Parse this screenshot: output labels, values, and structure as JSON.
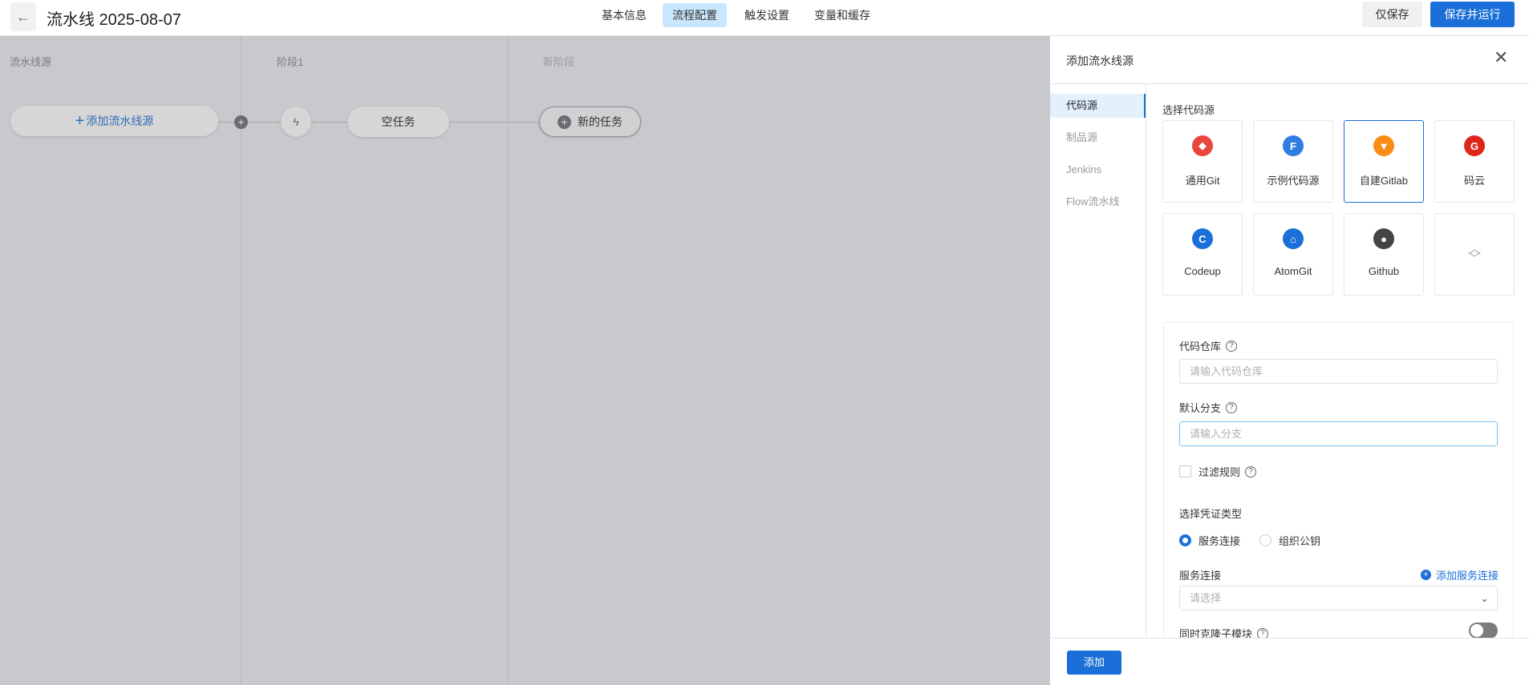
{
  "header": {
    "back_icon": "arrow-left-icon",
    "title": "流水线 2025-08-07",
    "tabs": [
      "基本信息",
      "流程配置",
      "触发设置",
      "变量和缓存"
    ],
    "active_tab": "流程配置",
    "save_only": "仅保存",
    "save_run": "保存并运行",
    "accent": "#1b6fd8"
  },
  "canvas": {
    "columns": [
      "流水线源",
      "阶段1",
      "新阶段"
    ],
    "add_source": "添加流水线源",
    "empty_task": "空任务",
    "new_task": "新的任务"
  },
  "panel": {
    "title": "添加流水线源",
    "side": [
      "代码源",
      "制品源",
      "Jenkins",
      "Flow流水线"
    ],
    "select_label": "选择代码源",
    "sources": [
      {
        "label": "通用Git",
        "icon": "git-icon",
        "color": "#e8463c"
      },
      {
        "label": "示例代码源",
        "icon": "flow-f-icon",
        "color": "#2f7de1"
      },
      {
        "label": "自建Gitlab",
        "icon": "gitlab-icon",
        "color": "#fa8c16"
      },
      {
        "label": "码云",
        "icon": "gitee-icon",
        "color": "#e1251b"
      },
      {
        "label": "Codeup",
        "icon": "codeup-icon",
        "color": "#1b6fd8"
      },
      {
        "label": "AtomGit",
        "icon": "atomgit-icon",
        "color": "#1b6fd8"
      },
      {
        "label": "Github",
        "icon": "github-icon",
        "color": "#444"
      }
    ],
    "selected_source": "自建Gitlab",
    "form": {
      "repo_label": "代码仓库",
      "repo_placeholder": "请输入代码仓库",
      "branch_label": "默认分支",
      "branch_placeholder": "请输入分支",
      "filter_label": "过滤规则",
      "cred_label": "选择凭证类型",
      "radio1": "服务连接",
      "radio2": "组织公钥",
      "conn_label": "服务连接",
      "add_conn": "添加服务连接",
      "select_placeholder": "请选择",
      "submodule_label": "同时克隆子模块"
    },
    "add_button": "添加"
  }
}
